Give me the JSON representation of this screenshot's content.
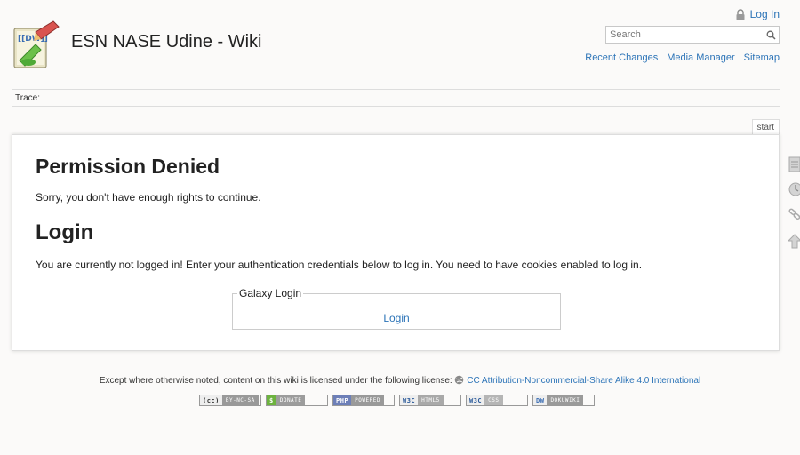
{
  "header": {
    "site_title": "ESN NASE Udine - Wiki",
    "logo_icon": "dokuwiki-logo-icon",
    "login_label": "Log In",
    "search": {
      "placeholder": "Search"
    },
    "sitetools": [
      {
        "label": "Recent Changes"
      },
      {
        "label": "Media Manager"
      },
      {
        "label": "Sitemap"
      }
    ]
  },
  "breadcrumb": {
    "label": "Trace:"
  },
  "pageid": "start",
  "content": {
    "heading1": "Permission Denied",
    "para1": "Sorry, you don't have enough rights to continue.",
    "heading2": "Login",
    "para2": "You are currently not logged in! Enter your authentication credentials below to log in. You need to have cookies enabled to log in.",
    "fieldset_legend": "Galaxy Login",
    "login_button": "Login"
  },
  "pagetools": [
    "page-icon",
    "history-icon",
    "backlinks-icon",
    "back-to-top-icon"
  ],
  "footer": {
    "license_prefix": "Except where otherwise noted, content on this wiki is licensed under the following license:",
    "license_link": "CC Attribution-Noncommercial-Share Alike 4.0 International",
    "badges": [
      {
        "left": "(cc)",
        "right": "BY-NC-SA"
      },
      {
        "left": "$",
        "right": "DONATE"
      },
      {
        "left": "PHP",
        "right": "POWERED"
      },
      {
        "left": "W3C",
        "right": "HTML5"
      },
      {
        "left": "W3C",
        "right": "CSS"
      },
      {
        "left": "DW",
        "right": "DOKUWIKI"
      }
    ]
  },
  "colors": {
    "link": "#2b73b7",
    "background": "#fbfaf9",
    "panel": "#ffffff"
  }
}
